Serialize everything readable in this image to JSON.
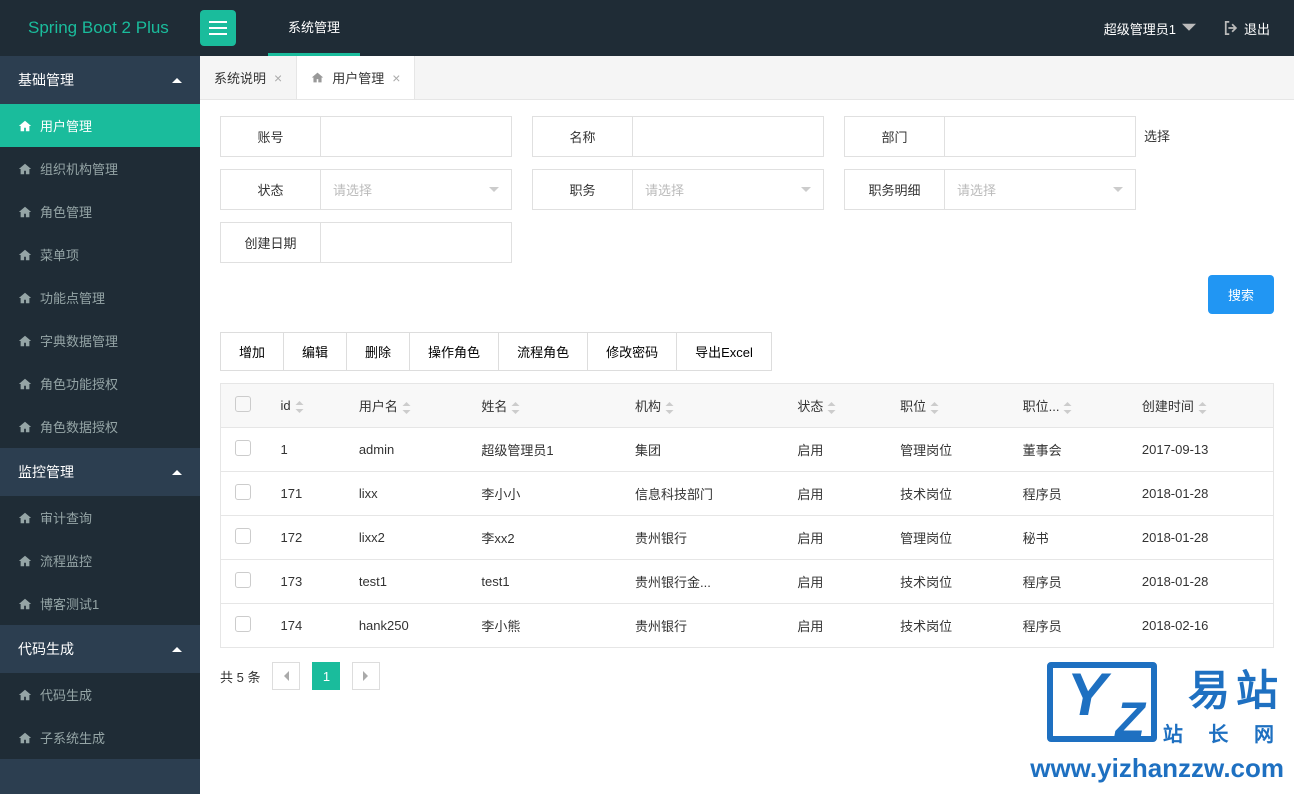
{
  "logo": "Spring Boot 2 Plus",
  "topNav": "系统管理",
  "user": {
    "name": "超级管理员1",
    "logout": "退出"
  },
  "sidebar": {
    "groups": [
      {
        "label": "基础管理"
      },
      {
        "label": "监控管理"
      },
      {
        "label": "代码生成"
      }
    ],
    "g0": [
      "用户管理",
      "组织机构管理",
      "角色管理",
      "菜单项",
      "功能点管理",
      "字典数据管理",
      "角色功能授权",
      "角色数据授权"
    ],
    "g1": [
      "审计查询",
      "流程监控",
      "博客测试1"
    ],
    "g2": [
      "代码生成",
      "子系统生成"
    ]
  },
  "tabs": [
    {
      "label": "系统说明"
    },
    {
      "label": "用户管理"
    }
  ],
  "search": {
    "account": "账号",
    "name": "名称",
    "dept": "部门",
    "selectBtn": "选择",
    "status": "状态",
    "job": "职务",
    "jobDetail": "职务明细",
    "createDate": "创建日期",
    "placeholder": "请选择",
    "searchBtn": "搜索"
  },
  "toolbar": [
    "增加",
    "编辑",
    "删除",
    "操作角色",
    "流程角色",
    "修改密码",
    "导出Excel"
  ],
  "table": {
    "headers": [
      "id",
      "用户名",
      "姓名",
      "机构",
      "状态",
      "职位",
      "职位...",
      "创建时间"
    ],
    "rows": [
      {
        "id": "1",
        "user": "admin",
        "name": "超级管理员1",
        "org": "集团",
        "status": "启用",
        "pos": "管理岗位",
        "posd": "董事会",
        "created": "2017-09-13"
      },
      {
        "id": "171",
        "user": "lixx",
        "name": "李小小",
        "org": "信息科技部门",
        "status": "启用",
        "pos": "技术岗位",
        "posd": "程序员",
        "created": "2018-01-28"
      },
      {
        "id": "172",
        "user": "lixx2",
        "name": "李xx2",
        "org": "贵州银行",
        "status": "启用",
        "pos": "管理岗位",
        "posd": "秘书",
        "created": "2018-01-28"
      },
      {
        "id": "173",
        "user": "test1",
        "name": "test1",
        "org": "贵州银行金...",
        "status": "启用",
        "pos": "技术岗位",
        "posd": "程序员",
        "created": "2018-01-28"
      },
      {
        "id": "174",
        "user": "hank250",
        "name": "李小熊",
        "org": "贵州银行",
        "status": "启用",
        "pos": "技术岗位",
        "posd": "程序员",
        "created": "2018-02-16"
      }
    ]
  },
  "pagination": {
    "total": "共 5 条",
    "page": "1"
  },
  "watermark": {
    "brand1": "易站",
    "brand2": "站 长 网",
    "url": "www.yizhanzzw.com"
  }
}
